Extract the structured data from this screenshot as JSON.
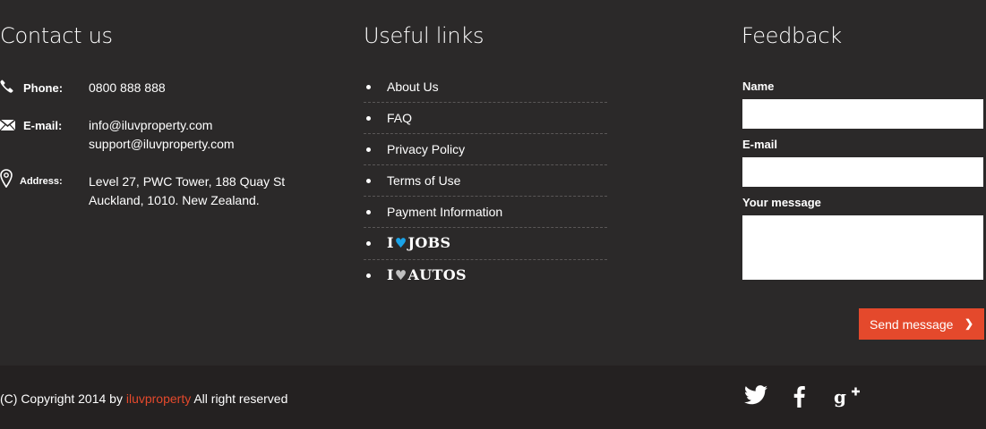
{
  "contact": {
    "title": "Contact us",
    "phone": {
      "label": "Phone:",
      "value": "0800 888 888",
      "icon": "phone-icon"
    },
    "email": {
      "label": "E-mail:",
      "value1": "info@iluvproperty.com",
      "value2": "support@iluvproperty.com",
      "icon": "mail-icon"
    },
    "address": {
      "label": "Address:",
      "line1": "Level 27, PWC Tower, 188 Quay St",
      "line2": "Auckland, 1010. New Zealand.",
      "icon": "map-pin-icon"
    }
  },
  "links": {
    "title": "Useful links",
    "items": [
      "About Us",
      "FAQ",
      "Privacy Policy",
      "Terms of Use",
      "Payment Information"
    ],
    "brands": [
      {
        "prefix": "I",
        "suffix": "JOBS",
        "heart_color": "#1aa3e8"
      },
      {
        "prefix": "I",
        "suffix": "AUTOS",
        "heart_color": "#bfbfbf"
      }
    ]
  },
  "feedback": {
    "title": "Feedback",
    "name_label": "Name",
    "name_value": "",
    "email_label": "E-mail",
    "email_value": "",
    "message_label": "Your message",
    "message_value": "",
    "send_label": "Send message",
    "send_icon": "chevron-right-icon"
  },
  "footer": {
    "copy_prefix": "(C) Copyright 2014 by ",
    "copy_brand": "iluvproperty",
    "copy_suffix": " All right reserved",
    "social": [
      "twitter-icon",
      "facebook-icon",
      "google-plus-icon"
    ]
  },
  "colors": {
    "background": "#2b2929",
    "bottom_bar": "#242121",
    "accent": "#e4492c",
    "jobs_heart": "#1aa3e8"
  }
}
